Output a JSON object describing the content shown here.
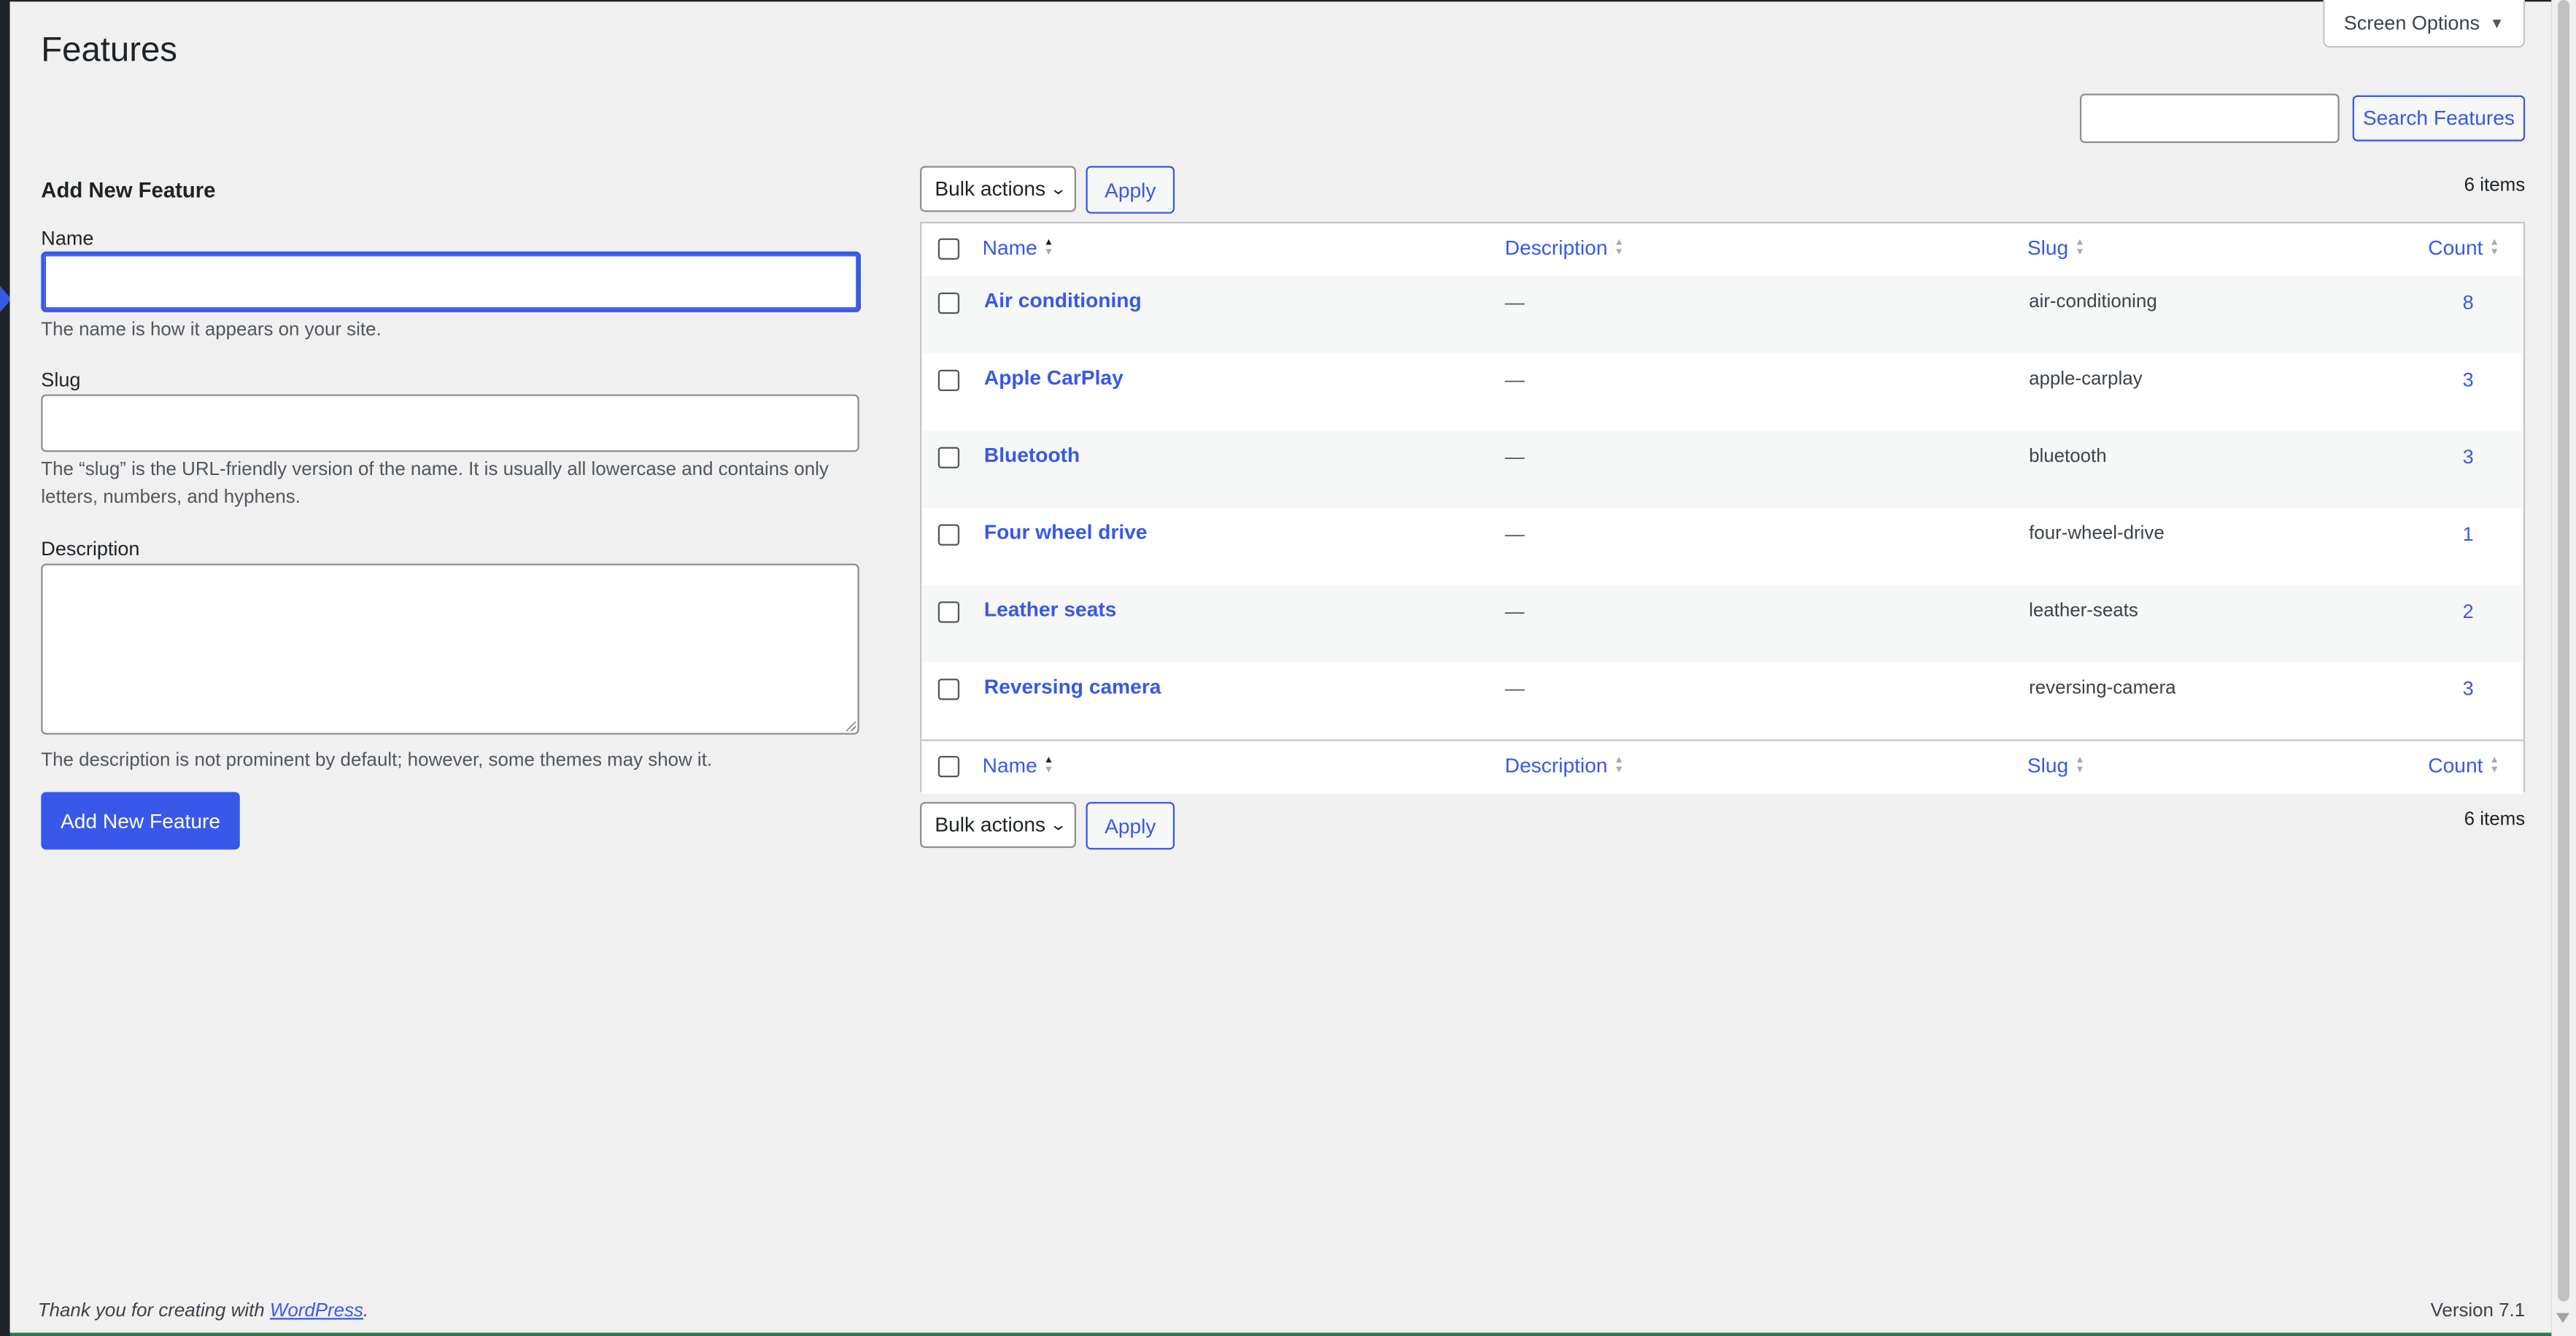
{
  "page": {
    "title": "Features"
  },
  "screen_options": {
    "label": "Screen Options",
    "caret": "▼"
  },
  "search": {
    "value": "",
    "button_label": "Search Features"
  },
  "form": {
    "title": "Add New Feature",
    "name_label": "Name",
    "name_value": "",
    "name_help": "The name is how it appears on your site.",
    "slug_label": "Slug",
    "slug_value": "",
    "slug_help": "The “slug” is the URL-friendly version of the name. It is usually all lowercase and contains only letters, numbers, and hyphens.",
    "description_label": "Description",
    "description_value": "",
    "description_help": "The description is not prominent by default; however, some themes may show it.",
    "submit_label": "Add New Feature"
  },
  "bulk": {
    "selected": "Bulk actions",
    "apply_label": "Apply"
  },
  "items_count": "6 items",
  "columns": {
    "name": "Name",
    "description": "Description",
    "slug": "Slug",
    "count": "Count"
  },
  "rows": [
    {
      "name": "Air conditioning",
      "description": "—",
      "slug": "air-conditioning",
      "count": "8"
    },
    {
      "name": "Apple CarPlay",
      "description": "—",
      "slug": "apple-carplay",
      "count": "3"
    },
    {
      "name": "Bluetooth",
      "description": "—",
      "slug": "bluetooth",
      "count": "3"
    },
    {
      "name": "Four wheel drive",
      "description": "—",
      "slug": "four-wheel-drive",
      "count": "1"
    },
    {
      "name": "Leather seats",
      "description": "—",
      "slug": "leather-seats",
      "count": "2"
    },
    {
      "name": "Reversing camera",
      "description": "—",
      "slug": "reversing-camera",
      "count": "3"
    }
  ],
  "footer": {
    "thanks_prefix": "Thank you for creating with ",
    "link_label": "WordPress",
    "thanks_suffix": ".",
    "version": "Version 7.1"
  },
  "colors": {
    "accent": "#3858e9",
    "background": "#f0f0f1",
    "admin_bar": "#1d2327"
  }
}
